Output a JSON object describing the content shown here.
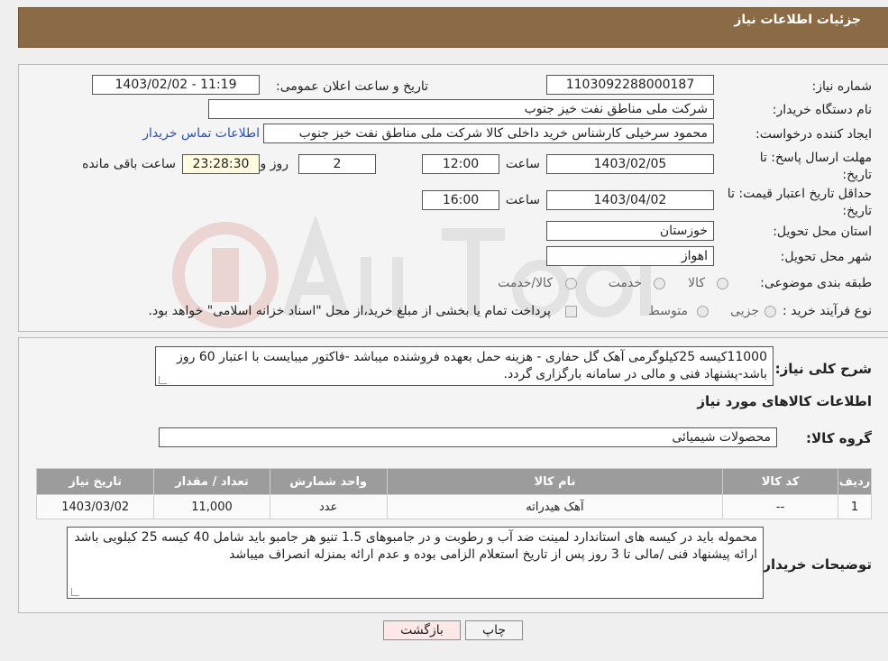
{
  "header": {
    "title": "جزئیات اطلاعات نیاز"
  },
  "info": {
    "need_number_label": "شماره نیاز:",
    "need_number": "1103092288000187",
    "announce_label": "تاریخ و ساعت اعلان عمومی:",
    "announce_value": "1403/02/02 - 11:19",
    "buyer_org_label": "نام دستگاه خریدار:",
    "buyer_org": "شرکت ملی مناطق نفت خیز جنوب",
    "creator_label": "ایجاد کننده درخواست:",
    "creator": "محمود سرخیلی کارشناس خرید داخلی کالا شرکت ملی مناطق نفت خیز جنوب",
    "contact_link": "اطلاعات تماس خریدار",
    "deadline_label": "مهلت ارسال پاسخ: تا تاریخ:",
    "deadline_date": "1403/02/05",
    "time_label": "ساعت",
    "deadline_time": "12:00",
    "days_value": "2",
    "days_label": "روز و",
    "remaining_value": "23:28:30",
    "remaining_label": "ساعت باقی مانده",
    "validity_label": "حداقل تاریخ اعتبار قیمت: تا تاریخ:",
    "validity_date": "1403/04/02",
    "validity_time": "16:00",
    "province_label": "استان محل تحویل:",
    "province": "خوزستان",
    "city_label": "شهر محل تحویل:",
    "city": "اهواز",
    "category_label": "طبقه بندی موضوعی:",
    "category_options": [
      "کالا",
      "خدمت",
      "کالا/خدمت"
    ],
    "process_label": "نوع فرآیند خرید :",
    "process_options": [
      "جزیی",
      "متوسط"
    ],
    "payment_note": "پرداخت تمام یا بخشی از مبلغ خرید،از محل \"اسناد خزانه اسلامی\" خواهد بود."
  },
  "summary": {
    "label": "شرح کلی نیاز:",
    "text": "11000کیسه 25کیلوگرمی آهک گل حفاری - هزینه حمل بعهده فروشنده میباشد -فاکتور میبایست با اعتبار 60 روز باشد-پشنهاد فنی و مالی در سامانه بارگزاری گردد.",
    "goods_title": "اطلاعات کالاهای مورد نیاز",
    "group_label": "گروه کالا:",
    "group_value": "محصولات شیمیائی"
  },
  "table": {
    "headers": [
      "ردیف",
      "کد کالا",
      "نام کالا",
      "واحد شمارش",
      "تعداد / مقدار",
      "تاریخ نیاز"
    ],
    "rows": [
      [
        "1",
        "--",
        "آهک هیدراته",
        "عدد",
        "11,000",
        "1403/03/02"
      ]
    ]
  },
  "buyer_notes": {
    "label": "توضیحات خریدار:",
    "text": "محموله باید در کیسه های استاندارد لمینت ضد آب و رطوبت و  در جامبوهای  1.5 تنیو هر جامبو باید شامل 40 کیسه 25 کیلویی باشد ارائه پیشنهاد فنی /مالی تا 3 روز پس از تاریخ استعلام الزامی بوده و عدم ارائه بمنزله انصراف میباشد"
  },
  "buttons": {
    "print": "چاپ",
    "back": "بازگشت"
  },
  "colors": {
    "header_bg": "#8b6b46",
    "table_header_bg": "#9c9c9c"
  }
}
